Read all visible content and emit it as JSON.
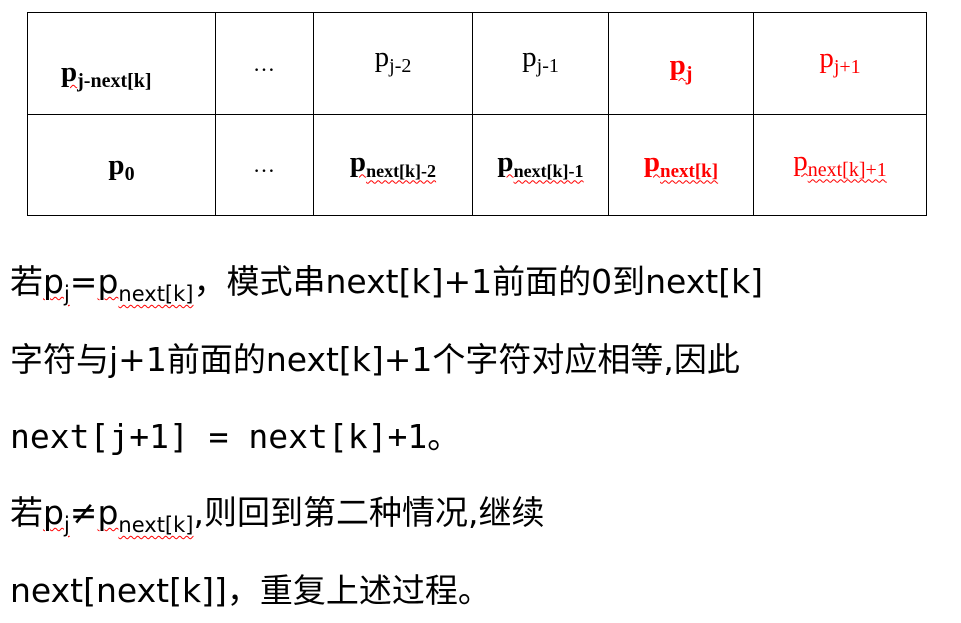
{
  "table": {
    "row1": [
      {
        "base": "p",
        "sub": "j-next[k]"
      },
      {
        "text": "…"
      },
      {
        "base": "p",
        "sub": "j-2"
      },
      {
        "base": "p",
        "sub": "j-1"
      },
      {
        "base": "p",
        "sub": "j"
      },
      {
        "base": "p",
        "sub": "j+1"
      }
    ],
    "row2": [
      {
        "base": "p",
        "sub": "0"
      },
      {
        "text": "…"
      },
      {
        "base": "p",
        "sub": "next[k]-2"
      },
      {
        "base": "p",
        "sub": "next[k]-1"
      },
      {
        "base": "p",
        "sub": "next[k]"
      },
      {
        "base": "p",
        "sub": "next[k]+1"
      }
    ]
  },
  "text": {
    "line1": {
      "pre": "若",
      "p1": "p",
      "s1": "j",
      "eq": "=",
      "p2": "p",
      "s2": "next[k]",
      "post": "，模式串next[k]+1前面的0到next[k]"
    },
    "line2": "字符与j+1前面的next[k]+1个字符对应相等,因此",
    "line3": "next[j+1] = next[k]+1。",
    "line4": {
      "pre": "若",
      "p1": "p",
      "s1": "j",
      "neq": "≠",
      "p2": "p",
      "s2": "next[k]",
      "post": ",则回到第二种情况,继续"
    },
    "line5": "next[next[k]]，重复上述过程。"
  },
  "colors": {
    "highlight": "#ff0000",
    "text": "#000000"
  }
}
